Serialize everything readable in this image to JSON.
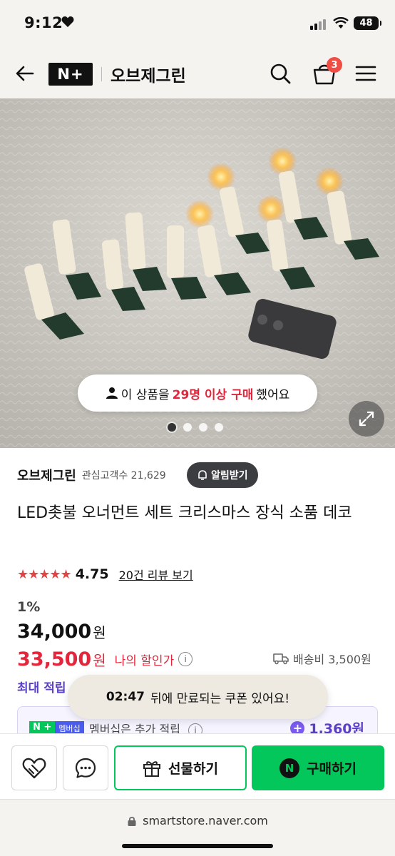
{
  "status_bar": {
    "time": "9:12",
    "battery": "48"
  },
  "header": {
    "logo_text": "N+",
    "store_name": "오브제그린",
    "cart_count": "3"
  },
  "hero": {
    "purchase_prefix": "이 상품을",
    "purchase_count": "29명 이상 구매",
    "purchase_suffix": "했어요",
    "page_total": 4,
    "page_current": 1
  },
  "store": {
    "name": "오브제그린",
    "fans_label": "관심고객수 21,629",
    "alert_button": "알림받기"
  },
  "product": {
    "title": "LED촛불 오너먼트 세트 크리스마스 장식 소품 데코",
    "rating_stars": "★★★★★",
    "rating": "4.75",
    "review_link": "20건 리뷰 보기",
    "discount_rate": "1%",
    "original_price": "34,000",
    "sale_price": "33,500",
    "currency": "원",
    "my_discount_label": "나의 할인가",
    "shipping": "배송비 3,500원",
    "max_points_label": "최대 적립"
  },
  "membership": {
    "badge_n": "N +",
    "badge_label": "멤버십",
    "text": "멤버십은 추가 적립",
    "points": "1,360원"
  },
  "coupon_toast": {
    "timer": "02:47",
    "message": "뒤에 만료되는 쿠폰 있어요!"
  },
  "actions": {
    "gift_label": "선물하기",
    "buy_label": "구매하기"
  },
  "browser": {
    "url": "smartstore.naver.com"
  },
  "colors": {
    "naver_green": "#03c75a",
    "sale_red": "#e3263b",
    "points_purple": "#5b3fc7"
  }
}
